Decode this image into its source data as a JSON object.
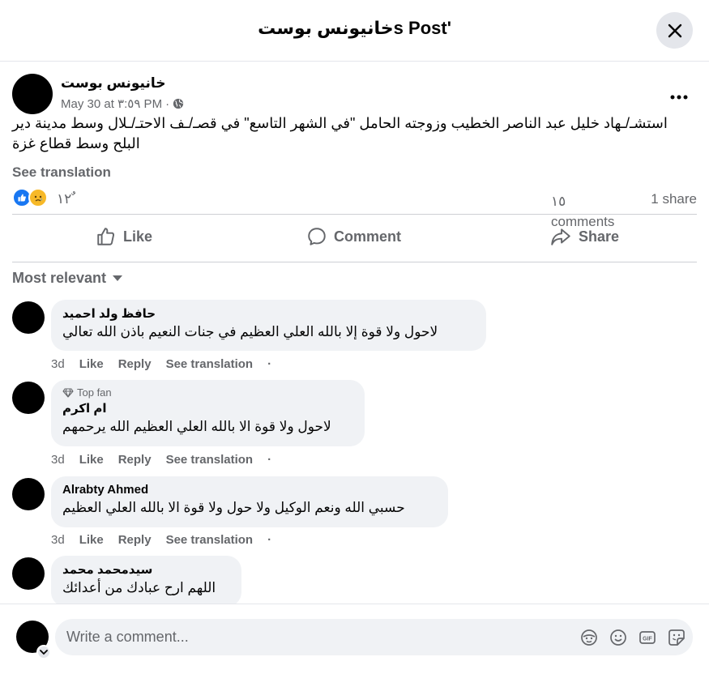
{
  "dialog": {
    "title": "خانيونس بوستs Post'",
    "close_icon": "close-icon"
  },
  "post": {
    "page_name": "خانيونس بوست",
    "timestamp": "May 30 at ٣:٥٩ PM",
    "separator": "·",
    "audience_icon": "globe-icon",
    "text": "استشـ/ـهاد خليل عبد الناصر الخطيب وزوجته الحامل \"في الشهر التاسع\" في قصـ/ـف الاحتـ/ـلال وسط مدينة دير البلح وسط قطاع غزة",
    "see_translation": "See translation",
    "reactions": {
      "icons": [
        "like-icon",
        "sad-icon"
      ],
      "count": "١٢ ٌ"
    },
    "comments_count": "١٥ comments",
    "shares_count": "1 share"
  },
  "actions": {
    "like": "Like",
    "comment": "Comment",
    "share": "Share"
  },
  "sort": {
    "label": "Most relevant"
  },
  "comments": [
    {
      "author": "حافظ ولد احميد",
      "text": "لاحول ولا قوة إلا بالله العلي العظيم في جنات النعيم باذن الله تعالي",
      "time": "3d",
      "like": "Like",
      "reply": "Reply",
      "translate": "See translation",
      "dot": "·"
    },
    {
      "badge": "Top fan",
      "author": "ام اكرم",
      "text": "لاحول ولا قوة الا بالله العلي العظيم الله يرحمهم",
      "time": "3d",
      "like": "Like",
      "reply": "Reply",
      "translate": "See translation",
      "dot": "·"
    },
    {
      "author": "Alrabty Ahmed",
      "text": "حسبي الله ونعم الوكيل ولا حول ولا قوة الا بالله العلي العظيم",
      "time": "3d",
      "like": "Like",
      "reply": "Reply",
      "translate": "See translation",
      "dot": "·"
    },
    {
      "author": "سيدمحمد محمد",
      "text": "اللهم ارح عبادك من أعدائك"
    }
  ],
  "composer": {
    "placeholder": "Write a comment...",
    "icons": [
      "avatar-sticker-icon",
      "emoji-icon",
      "gif-icon",
      "sticker-icon"
    ]
  },
  "colors": {
    "accent": "#1877f2",
    "secondary_text": "#65676b",
    "bubble_bg": "#f0f2f5"
  }
}
